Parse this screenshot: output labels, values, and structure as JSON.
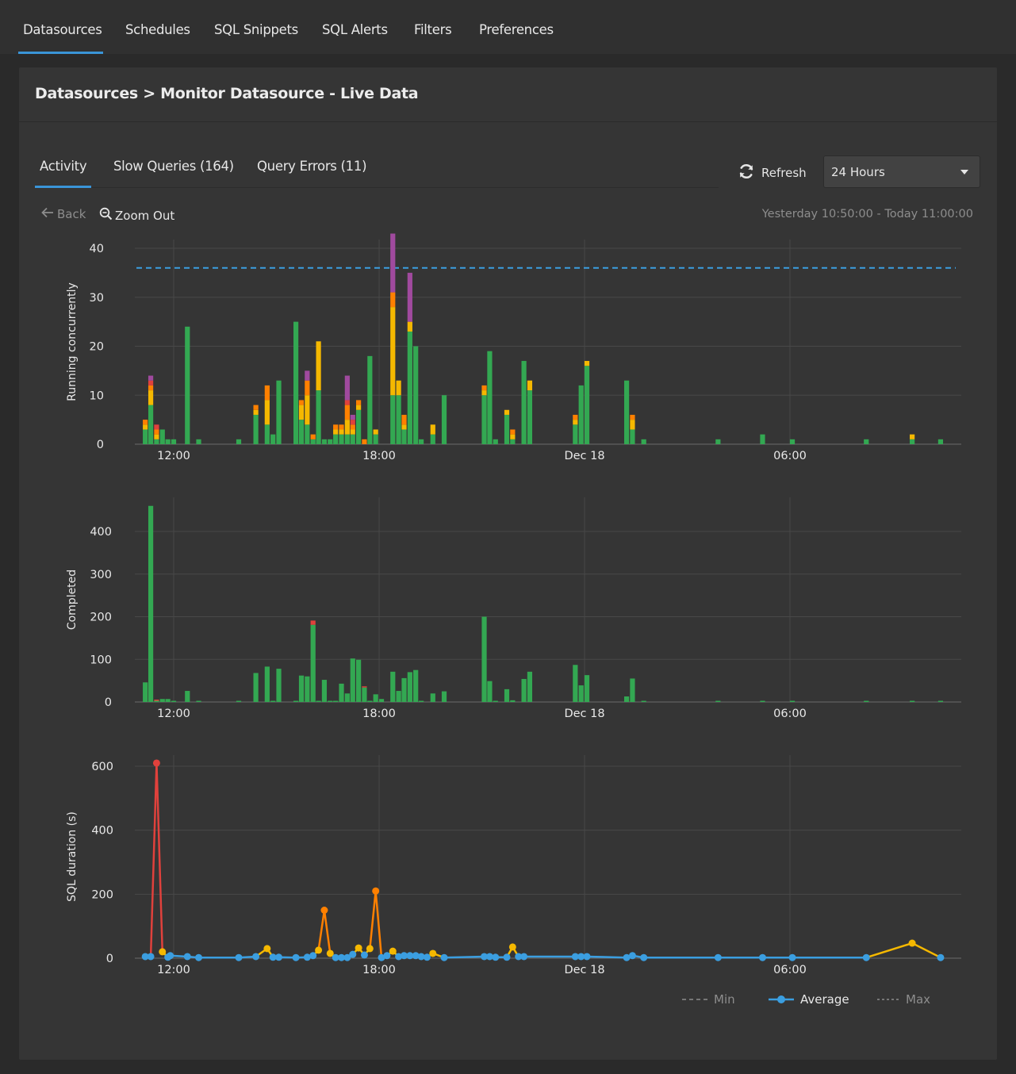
{
  "topnav": {
    "tabs": [
      {
        "label": "Datasources",
        "active": true
      },
      {
        "label": "Schedules"
      },
      {
        "label": "SQL Snippets"
      },
      {
        "label": "SQL Alerts"
      },
      {
        "label": "Filters"
      },
      {
        "label": "Preferences"
      }
    ]
  },
  "header": {
    "title": "Datasources > Monitor Datasource - Live Data"
  },
  "subtabs": [
    {
      "label": "Activity",
      "active": true
    },
    {
      "label": "Slow Queries (164)"
    },
    {
      "label": "Query Errors (11)"
    }
  ],
  "controls": {
    "refresh_label": "Refresh",
    "refresh_icon": "refresh-icon",
    "time_range_selected": "24 Hours",
    "back_label": "Back",
    "zoom_out_label": "Zoom Out",
    "range_text": "Yesterday 10:50:00 - Today 11:00:00"
  },
  "colors": {
    "accent": "#3a95d8",
    "green": "#33a852",
    "yellow": "#f5b800",
    "orange": "#ff8000",
    "red": "#e0413c",
    "purple": "#a04a9e",
    "blue": "#3b9ee0"
  },
  "chart_data": [
    {
      "type": "bar",
      "stacked": true,
      "title": "",
      "ylabel": "Running concurrently",
      "xlabel": "",
      "x_unit": "hours since yesterday 00:00",
      "xlim": [
        10.87,
        35.0
      ],
      "ylim": [
        0,
        40
      ],
      "yticks": [
        0,
        10,
        20,
        30,
        40
      ],
      "xticks": [
        {
          "at": 12,
          "label": "12:00"
        },
        {
          "at": 18,
          "label": "18:00"
        },
        {
          "at": 24,
          "label": "Dec 18"
        },
        {
          "at": 30,
          "label": "06:00"
        }
      ],
      "grid": true,
      "reference_line": {
        "value": 36,
        "style": "dashed",
        "color": "#3b9ee0"
      },
      "series_order": [
        "green",
        "yellow",
        "orange",
        "red",
        "purple"
      ],
      "bars": [
        {
          "x": 11.17,
          "g": 3,
          "y": 1,
          "o": 1,
          "r": 0,
          "p": 0
        },
        {
          "x": 11.33,
          "g": 8,
          "y": 3,
          "o": 1,
          "r": 1,
          "p": 1
        },
        {
          "x": 11.5,
          "g": 1,
          "y": 1,
          "o": 1,
          "r": 1,
          "p": 0
        },
        {
          "x": 11.67,
          "g": 3,
          "y": 0,
          "o": 0,
          "r": 0,
          "p": 0
        },
        {
          "x": 11.83,
          "g": 1,
          "y": 0,
          "o": 0,
          "r": 0,
          "p": 0
        },
        {
          "x": 12.0,
          "g": 1,
          "y": 0,
          "o": 0,
          "r": 0,
          "p": 0
        },
        {
          "x": 12.4,
          "g": 24,
          "y": 0,
          "o": 0,
          "r": 0,
          "p": 0
        },
        {
          "x": 12.73,
          "g": 1,
          "y": 0,
          "o": 0,
          "r": 0,
          "p": 0
        },
        {
          "x": 13.9,
          "g": 1,
          "y": 0,
          "o": 0,
          "r": 0,
          "p": 0
        },
        {
          "x": 14.4,
          "g": 6,
          "y": 1,
          "o": 1,
          "r": 0,
          "p": 0
        },
        {
          "x": 14.73,
          "g": 4,
          "y": 5,
          "o": 3,
          "r": 0,
          "p": 0
        },
        {
          "x": 14.9,
          "g": 2,
          "y": 0,
          "o": 0,
          "r": 0,
          "p": 0
        },
        {
          "x": 15.07,
          "g": 13,
          "y": 0,
          "o": 0,
          "r": 0,
          "p": 0
        },
        {
          "x": 15.57,
          "g": 25,
          "y": 0,
          "o": 0,
          "r": 0,
          "p": 0
        },
        {
          "x": 15.73,
          "g": 5,
          "y": 3,
          "o": 1,
          "r": 0,
          "p": 0
        },
        {
          "x": 15.9,
          "g": 4,
          "y": 6,
          "o": 3,
          "r": 0,
          "p": 2
        },
        {
          "x": 16.07,
          "g": 1,
          "y": 0,
          "o": 1,
          "r": 0,
          "p": 0
        },
        {
          "x": 16.23,
          "g": 11,
          "y": 10,
          "o": 0,
          "r": 0,
          "p": 0
        },
        {
          "x": 16.4,
          "g": 1,
          "y": 0,
          "o": 0,
          "r": 0,
          "p": 0
        },
        {
          "x": 16.57,
          "g": 1,
          "y": 0,
          "o": 0,
          "r": 0,
          "p": 0
        },
        {
          "x": 16.73,
          "g": 2,
          "y": 1,
          "o": 1,
          "r": 0,
          "p": 0
        },
        {
          "x": 16.9,
          "g": 2,
          "y": 1,
          "o": 1,
          "r": 0,
          "p": 0
        },
        {
          "x": 17.07,
          "g": 2,
          "y": 3,
          "o": 3,
          "r": 1,
          "p": 5
        },
        {
          "x": 17.23,
          "g": 2,
          "y": 1,
          "o": 1,
          "r": 1,
          "p": 1
        },
        {
          "x": 17.4,
          "g": 7,
          "y": 1,
          "o": 1,
          "r": 0,
          "p": 0
        },
        {
          "x": 17.57,
          "g": 0,
          "y": 0,
          "o": 1,
          "r": 0,
          "p": 0
        },
        {
          "x": 17.73,
          "g": 18,
          "y": 0,
          "o": 0,
          "r": 0,
          "p": 0
        },
        {
          "x": 17.9,
          "g": 2,
          "y": 1,
          "o": 0,
          "r": 0,
          "p": 0
        },
        {
          "x": 18.4,
          "g": 10,
          "y": 18,
          "o": 3,
          "r": 0,
          "p": 12
        },
        {
          "x": 18.57,
          "g": 10,
          "y": 3,
          "o": 0,
          "r": 0,
          "p": 0
        },
        {
          "x": 18.73,
          "g": 3,
          "y": 1,
          "o": 2,
          "r": 0,
          "p": 0
        },
        {
          "x": 18.9,
          "g": 23,
          "y": 2,
          "o": 0,
          "r": 0,
          "p": 10
        },
        {
          "x": 19.07,
          "g": 20,
          "y": 0,
          "o": 0,
          "r": 0,
          "p": 0
        },
        {
          "x": 19.23,
          "g": 1,
          "y": 0,
          "o": 0,
          "r": 0,
          "p": 0
        },
        {
          "x": 19.57,
          "g": 2,
          "y": 2,
          "o": 0,
          "r": 0,
          "p": 0
        },
        {
          "x": 19.9,
          "g": 10,
          "y": 0,
          "o": 0,
          "r": 0,
          "p": 0
        },
        {
          "x": 21.07,
          "g": 10,
          "y": 1,
          "o": 1,
          "r": 0,
          "p": 0
        },
        {
          "x": 21.23,
          "g": 19,
          "y": 0,
          "o": 0,
          "r": 0,
          "p": 0
        },
        {
          "x": 21.4,
          "g": 1,
          "y": 0,
          "o": 0,
          "r": 0,
          "p": 0
        },
        {
          "x": 21.73,
          "g": 6,
          "y": 1,
          "o": 0,
          "r": 0,
          "p": 0
        },
        {
          "x": 21.9,
          "g": 1,
          "y": 1,
          "o": 1,
          "r": 0,
          "p": 0
        },
        {
          "x": 22.23,
          "g": 17,
          "y": 0,
          "o": 0,
          "r": 0,
          "p": 0
        },
        {
          "x": 22.4,
          "g": 11,
          "y": 2,
          "o": 0,
          "r": 0,
          "p": 0
        },
        {
          "x": 23.73,
          "g": 4,
          "y": 1,
          "o": 1,
          "r": 0,
          "p": 0
        },
        {
          "x": 23.9,
          "g": 12,
          "y": 0,
          "o": 0,
          "r": 0,
          "p": 0
        },
        {
          "x": 24.07,
          "g": 16,
          "y": 1,
          "o": 0,
          "r": 0,
          "p": 0
        },
        {
          "x": 25.23,
          "g": 13,
          "y": 0,
          "o": 0,
          "r": 0,
          "p": 0
        },
        {
          "x": 25.4,
          "g": 3,
          "y": 2,
          "o": 1,
          "r": 0,
          "p": 0
        },
        {
          "x": 25.73,
          "g": 1,
          "y": 0,
          "o": 0,
          "r": 0,
          "p": 0
        },
        {
          "x": 27.9,
          "g": 1,
          "y": 0,
          "o": 0,
          "r": 0,
          "p": 0
        },
        {
          "x": 29.2,
          "g": 2,
          "y": 0,
          "o": 0,
          "r": 0,
          "p": 0
        },
        {
          "x": 30.07,
          "g": 1,
          "y": 0,
          "o": 0,
          "r": 0,
          "p": 0
        },
        {
          "x": 32.23,
          "g": 1,
          "y": 0,
          "o": 0,
          "r": 0,
          "p": 0
        },
        {
          "x": 33.57,
          "g": 1,
          "y": 1,
          "o": 0,
          "r": 0,
          "p": 0
        },
        {
          "x": 34.4,
          "g": 1,
          "y": 0,
          "o": 0,
          "r": 0,
          "p": 0
        }
      ]
    },
    {
      "type": "bar",
      "stacked": true,
      "title": "",
      "ylabel": "Completed",
      "xlabel": "",
      "x_unit": "hours since yesterday 00:00",
      "xlim": [
        10.87,
        35.0
      ],
      "ylim": [
        0,
        480
      ],
      "yticks": [
        0,
        100,
        200,
        300,
        400
      ],
      "xticks": [
        {
          "at": 12,
          "label": "12:00"
        },
        {
          "at": 18,
          "label": "18:00"
        },
        {
          "at": 24,
          "label": "Dec 18"
        },
        {
          "at": 30,
          "label": "06:00"
        }
      ],
      "grid": true,
      "series_order": [
        "success",
        "error"
      ],
      "bars": [
        {
          "x": 11.17,
          "ok": 46,
          "err": 0
        },
        {
          "x": 11.33,
          "ok": 460,
          "err": 0
        },
        {
          "x": 11.5,
          "ok": 1,
          "err": 1
        },
        {
          "x": 11.67,
          "ok": 7,
          "err": 0
        },
        {
          "x": 11.83,
          "ok": 7,
          "err": 0
        },
        {
          "x": 12.0,
          "ok": 1,
          "err": 0
        },
        {
          "x": 12.4,
          "ok": 26,
          "err": 0
        },
        {
          "x": 12.73,
          "ok": 1,
          "err": 0
        },
        {
          "x": 13.9,
          "ok": 1,
          "err": 0
        },
        {
          "x": 14.4,
          "ok": 68,
          "err": 0
        },
        {
          "x": 14.73,
          "ok": 83,
          "err": 0
        },
        {
          "x": 14.9,
          "ok": 2,
          "err": 0
        },
        {
          "x": 15.07,
          "ok": 78,
          "err": 0
        },
        {
          "x": 15.57,
          "ok": 1,
          "err": 0
        },
        {
          "x": 15.73,
          "ok": 62,
          "err": 0
        },
        {
          "x": 15.9,
          "ok": 60,
          "err": 0
        },
        {
          "x": 16.07,
          "ok": 181,
          "err": 10
        },
        {
          "x": 16.23,
          "ok": 2,
          "err": 0
        },
        {
          "x": 16.4,
          "ok": 52,
          "err": 0
        },
        {
          "x": 16.57,
          "ok": 1,
          "err": 0
        },
        {
          "x": 16.73,
          "ok": 1,
          "err": 0
        },
        {
          "x": 16.9,
          "ok": 43,
          "err": 0
        },
        {
          "x": 17.07,
          "ok": 20,
          "err": 0
        },
        {
          "x": 17.23,
          "ok": 102,
          "err": 0
        },
        {
          "x": 17.4,
          "ok": 99,
          "err": 0
        },
        {
          "x": 17.57,
          "ok": 34,
          "err": 1
        },
        {
          "x": 17.73,
          "ok": 1,
          "err": 0
        },
        {
          "x": 17.9,
          "ok": 18,
          "err": 0
        },
        {
          "x": 18.07,
          "ok": 7,
          "err": 0
        },
        {
          "x": 18.4,
          "ok": 71,
          "err": 0
        },
        {
          "x": 18.57,
          "ok": 26,
          "err": 0
        },
        {
          "x": 18.73,
          "ok": 56,
          "err": 0
        },
        {
          "x": 18.9,
          "ok": 70,
          "err": 0
        },
        {
          "x": 19.07,
          "ok": 75,
          "err": 0
        },
        {
          "x": 19.23,
          "ok": 1,
          "err": 0
        },
        {
          "x": 19.57,
          "ok": 20,
          "err": 0
        },
        {
          "x": 19.9,
          "ok": 25,
          "err": 0
        },
        {
          "x": 21.07,
          "ok": 200,
          "err": 0
        },
        {
          "x": 21.23,
          "ok": 49,
          "err": 0
        },
        {
          "x": 21.4,
          "ok": 1,
          "err": 0
        },
        {
          "x": 21.73,
          "ok": 30,
          "err": 0
        },
        {
          "x": 21.9,
          "ok": 4,
          "err": 0
        },
        {
          "x": 22.23,
          "ok": 54,
          "err": 0
        },
        {
          "x": 22.4,
          "ok": 71,
          "err": 0
        },
        {
          "x": 23.73,
          "ok": 87,
          "err": 0
        },
        {
          "x": 23.9,
          "ok": 39,
          "err": 0
        },
        {
          "x": 24.07,
          "ok": 63,
          "err": 0
        },
        {
          "x": 25.23,
          "ok": 13,
          "err": 0
        },
        {
          "x": 25.4,
          "ok": 55,
          "err": 0
        },
        {
          "x": 25.73,
          "ok": 1,
          "err": 0
        },
        {
          "x": 27.9,
          "ok": 1,
          "err": 0
        },
        {
          "x": 29.2,
          "ok": 2,
          "err": 0
        },
        {
          "x": 30.07,
          "ok": 1,
          "err": 0
        },
        {
          "x": 32.23,
          "ok": 1,
          "err": 0
        },
        {
          "x": 33.57,
          "ok": 1,
          "err": 0
        },
        {
          "x": 34.4,
          "ok": 1,
          "err": 0
        }
      ]
    },
    {
      "type": "line",
      "title": "",
      "ylabel": "SQL duration (s)",
      "xlabel": "",
      "x_unit": "hours since yesterday 00:00",
      "xlim": [
        10.87,
        35.0
      ],
      "ylim": [
        0,
        600
      ],
      "yticks": [
        0,
        200,
        400,
        600
      ],
      "xticks": [
        {
          "at": 12,
          "label": "12:00"
        },
        {
          "at": 18,
          "label": "18:00"
        },
        {
          "at": 24,
          "label": "Dec 18"
        },
        {
          "at": 30,
          "label": "06:00"
        }
      ],
      "grid": true,
      "legend": {
        "placement": "bottom-right",
        "entries": [
          {
            "label": "Min",
            "style": "dashed",
            "enabled": false
          },
          {
            "label": "Average",
            "style": "line-marker",
            "enabled": true
          },
          {
            "label": "Max",
            "style": "dotted",
            "enabled": false
          }
        ]
      },
      "series": [
        {
          "name": "Average",
          "points": [
            [
              11.17,
              5
            ],
            [
              11.33,
              5
            ],
            [
              11.5,
              610
            ],
            [
              11.67,
              20
            ],
            [
              11.83,
              3
            ],
            [
              11.9,
              8
            ],
            [
              12.4,
              5
            ],
            [
              12.73,
              2
            ],
            [
              13.9,
              2
            ],
            [
              14.4,
              5
            ],
            [
              14.73,
              30
            ],
            [
              14.9,
              3
            ],
            [
              15.07,
              3
            ],
            [
              15.57,
              2
            ],
            [
              15.9,
              3
            ],
            [
              16.07,
              8
            ],
            [
              16.23,
              25
            ],
            [
              16.4,
              150
            ],
            [
              16.57,
              15
            ],
            [
              16.73,
              2
            ],
            [
              16.9,
              2
            ],
            [
              17.07,
              2
            ],
            [
              17.23,
              12
            ],
            [
              17.4,
              32
            ],
            [
              17.57,
              10
            ],
            [
              17.73,
              30
            ],
            [
              17.9,
              210
            ],
            [
              18.07,
              2
            ],
            [
              18.23,
              8
            ],
            [
              18.4,
              22
            ],
            [
              18.57,
              5
            ],
            [
              18.73,
              8
            ],
            [
              18.9,
              8
            ],
            [
              19.07,
              8
            ],
            [
              19.23,
              5
            ],
            [
              19.4,
              3
            ],
            [
              19.57,
              15
            ],
            [
              19.9,
              2
            ],
            [
              21.07,
              5
            ],
            [
              21.23,
              5
            ],
            [
              21.4,
              3
            ],
            [
              21.73,
              3
            ],
            [
              21.9,
              35
            ],
            [
              22.07,
              5
            ],
            [
              22.23,
              5
            ],
            [
              23.73,
              5
            ],
            [
              23.9,
              5
            ],
            [
              24.07,
              5
            ],
            [
              25.23,
              2
            ],
            [
              25.4,
              8
            ],
            [
              25.73,
              2
            ],
            [
              27.9,
              2
            ],
            [
              29.2,
              2
            ],
            [
              30.07,
              2
            ],
            [
              32.23,
              2
            ],
            [
              33.57,
              47
            ],
            [
              34.4,
              2
            ]
          ]
        }
      ]
    }
  ]
}
